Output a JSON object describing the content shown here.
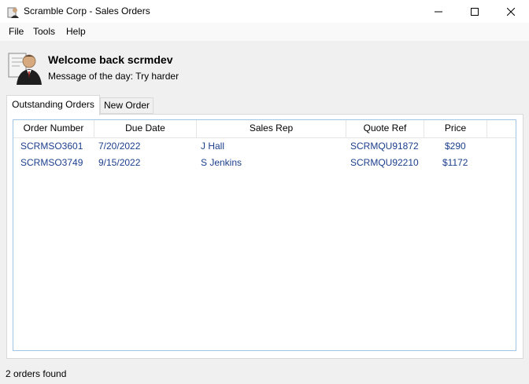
{
  "window": {
    "title": "Scramble Corp - Sales Orders",
    "icon": "briefcase-person-icon"
  },
  "menu": [
    "File",
    "Tools",
    "Help"
  ],
  "header": {
    "welcome": "Welcome back scrmdev",
    "motd": "Message of the day: Try harder",
    "icon": "user-profile-icon"
  },
  "tabs": [
    {
      "label": "Outstanding Orders",
      "active": true
    },
    {
      "label": "New Order",
      "active": false
    }
  ],
  "orders": {
    "columns": [
      "Order Number",
      "Due Date",
      "Sales Rep",
      "Quote Ref",
      "Price"
    ],
    "rows": [
      [
        "SCRMSO3601",
        "7/20/2022",
        "J Hall",
        "SCRMQU91872",
        "$290"
      ],
      [
        "SCRMSO3749",
        "9/15/2022",
        "S Jenkins",
        "SCRMQU92210",
        "$1172"
      ]
    ]
  },
  "status": "2 orders found",
  "colors": {
    "link_text": "#1c3f8c",
    "list_border": "#9fc3e0"
  }
}
